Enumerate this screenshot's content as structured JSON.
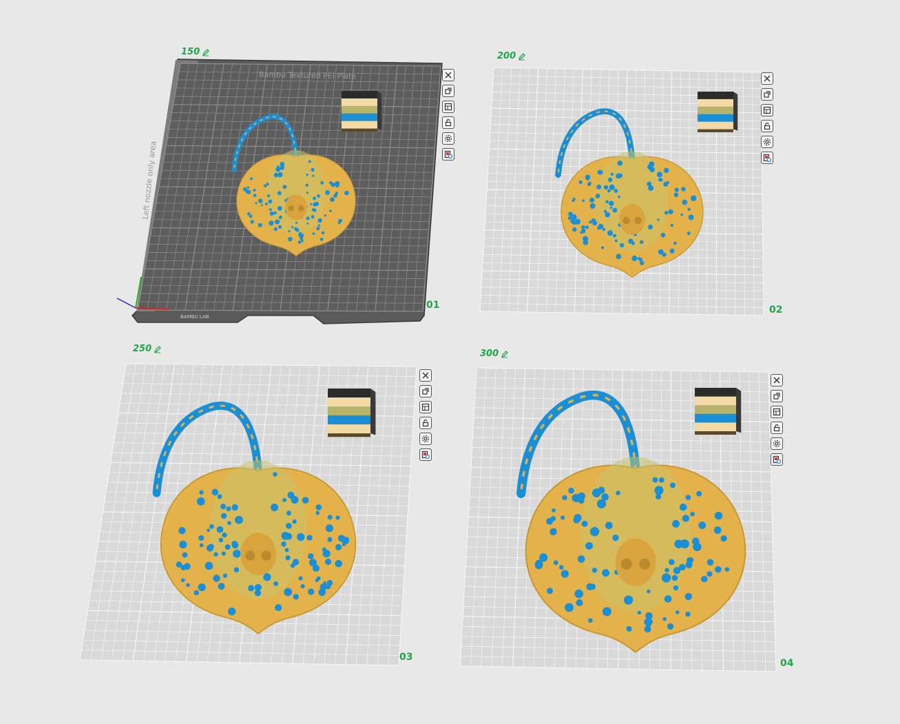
{
  "plates": [
    {
      "id": "plate-1",
      "scale": "150",
      "number": "01",
      "textured": true,
      "plate_name": "Bambu Textured PEI Plate",
      "side_text": "Left nozzle only area",
      "brand_text": "BAMBU LAB"
    },
    {
      "id": "plate-2",
      "scale": "200",
      "number": "02",
      "textured": false
    },
    {
      "id": "plate-3",
      "scale": "250",
      "number": "03",
      "textured": false
    },
    {
      "id": "plate-4",
      "scale": "300",
      "number": "04",
      "textured": false
    }
  ],
  "toolbar_icons": [
    "close-icon",
    "auto-orient-icon",
    "arrange-icon",
    "lock-icon",
    "settings-icon",
    "slice-plate-icon"
  ],
  "colors": {
    "accent_green": "#1fa64a",
    "ray_body": "#e4b24a",
    "ray_spots": "#1a8fd6",
    "filament_black": "#2b2b2b",
    "filament_cream": "#f3d9a6",
    "filament_olive": "#b7b36a",
    "filament_blue": "#1a8fd6"
  }
}
